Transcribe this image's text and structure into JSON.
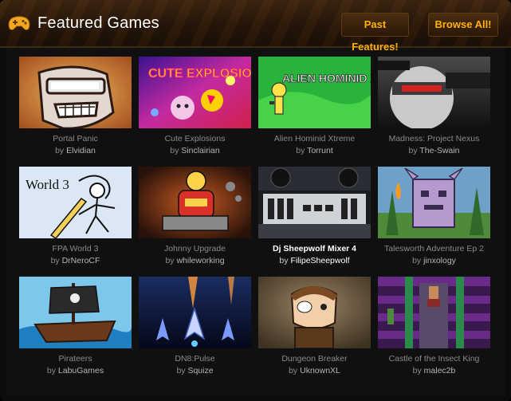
{
  "header": {
    "title": "Featured Games",
    "past_features_label": "Past Features!",
    "browse_all_label": "Browse All!",
    "accent_color": "#ffb000",
    "icon": "gamepad-icon"
  },
  "games": [
    {
      "name": "Portal Panic",
      "by": "by",
      "author": "Elvidian"
    },
    {
      "name": "Cute Explosions",
      "by": "by",
      "author": "Sinclairian",
      "art_text": "CUTE EXPLOSIONS"
    },
    {
      "name": "Alien Hominid Xtreme",
      "by": "by",
      "author": "Torrunt",
      "art_text": "ALIEN HOMINID XTREME!"
    },
    {
      "name": "Madness: Project Nexus",
      "by": "by",
      "author": "The-Swain"
    },
    {
      "name": "FPA World 3",
      "by": "by",
      "author": "DrNeroCF",
      "art_text": "World 3"
    },
    {
      "name": "Johnny Upgrade",
      "by": "by",
      "author": "whileworking"
    },
    {
      "name": "Dj  Sheepwolf Mixer 4",
      "by": "by",
      "author": "FilipeSheepwolf",
      "highlighted": true
    },
    {
      "name": "Talesworth Adventure Ep 2",
      "by": "by",
      "author": "jinxology"
    },
    {
      "name": "Pirateers",
      "by": "by",
      "author": "LabuGames"
    },
    {
      "name": "DN8:Pulse",
      "by": "by",
      "author": "Squize"
    },
    {
      "name": "Dungeon Breaker",
      "by": "by",
      "author": "UknownXL"
    },
    {
      "name": "Castle of the Insect King",
      "by": "by",
      "author": "malec2b"
    }
  ]
}
